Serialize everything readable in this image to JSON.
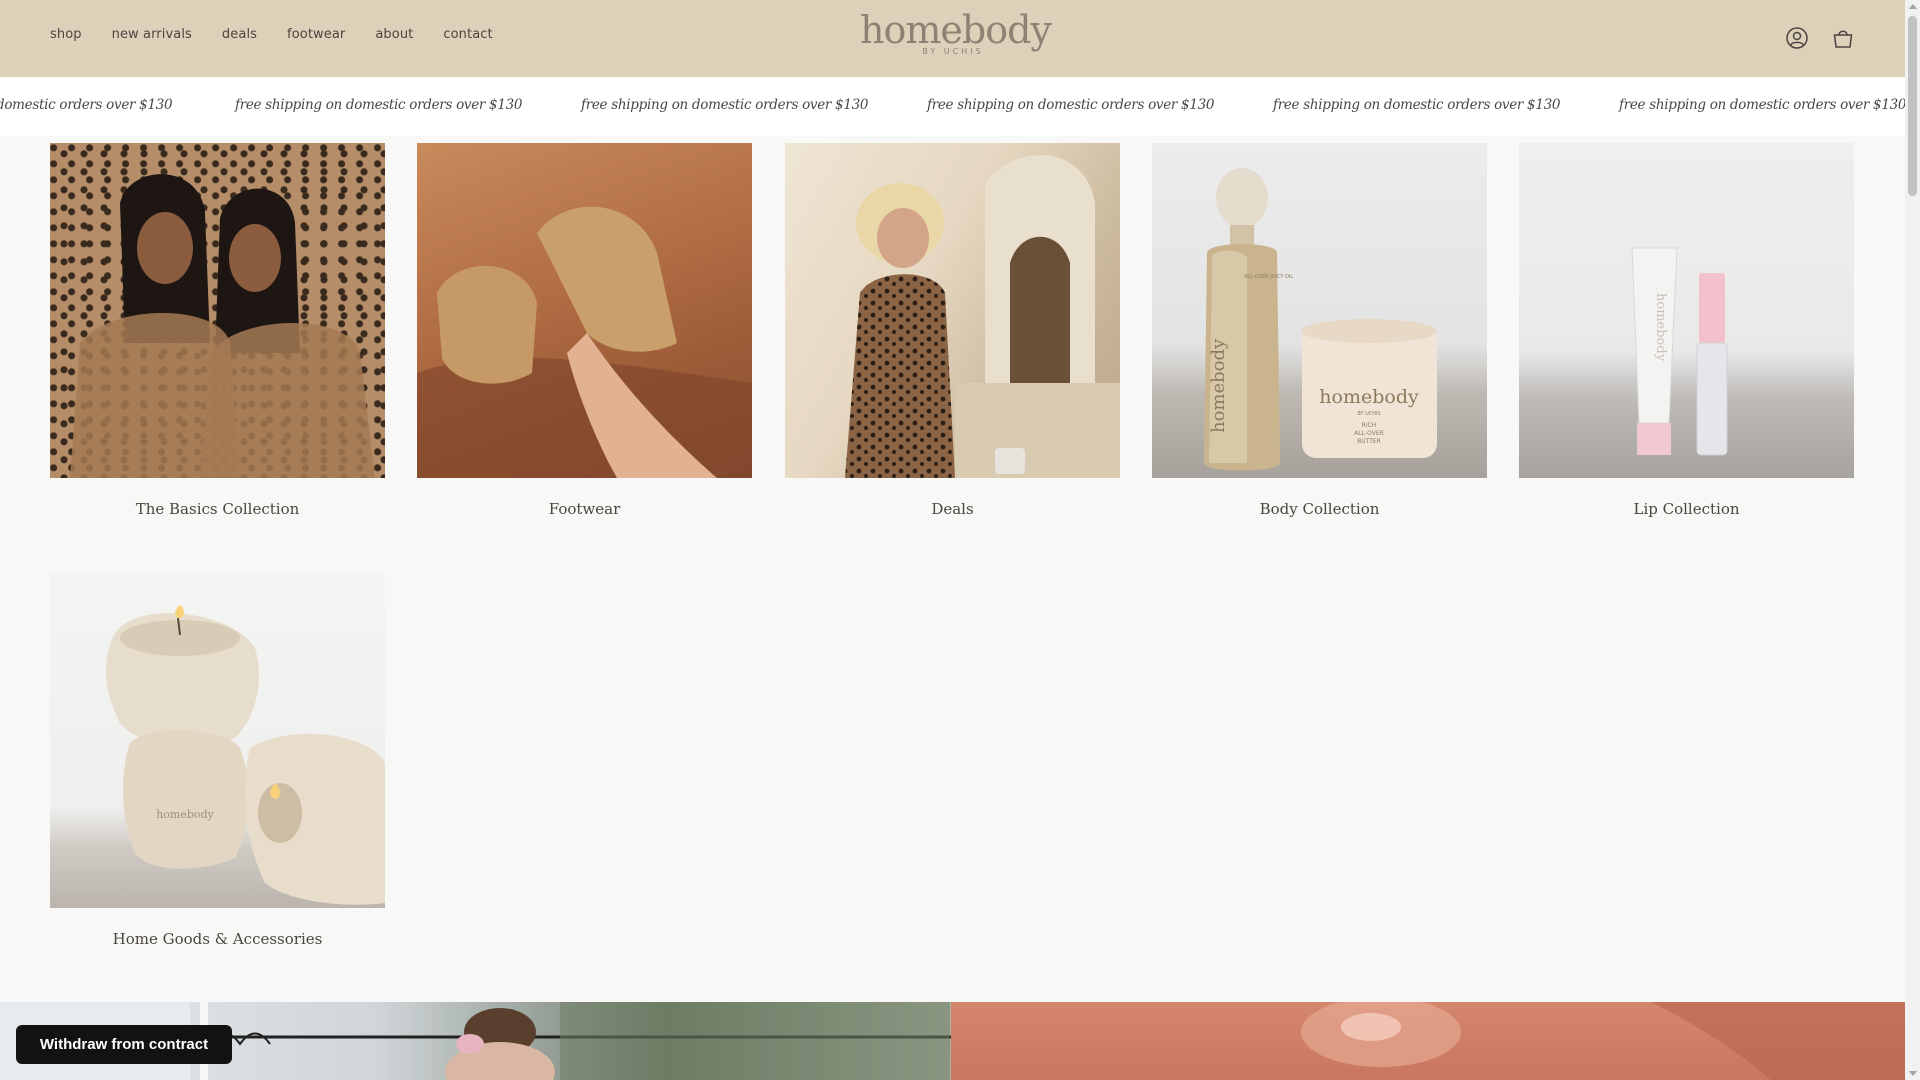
{
  "nav": {
    "items": [
      {
        "label": "shop"
      },
      {
        "label": "new arrivals"
      },
      {
        "label": "deals"
      },
      {
        "label": "footwear"
      },
      {
        "label": "about"
      },
      {
        "label": "contact"
      }
    ]
  },
  "logo": {
    "main": "homebody",
    "sub": "BY UCHIS"
  },
  "header_icons": [
    "account-icon",
    "cart-bag-icon"
  ],
  "announcement": {
    "messages": [
      "domestic orders over $130",
      "free shipping on domestic orders over $130",
      "free shipping on domestic orders over $130",
      "free shipping on domestic orders over $130",
      "free shipping on domestic orders over $130",
      "free shipping on domestic orders over $130"
    ]
  },
  "collections": [
    {
      "title": "The Basics Collection"
    },
    {
      "title": "Footwear"
    },
    {
      "title": "Deals"
    },
    {
      "title": "Body Collection"
    },
    {
      "title": "Lip Collection"
    },
    {
      "title": "Home Goods & Accessories"
    }
  ],
  "product_text": {
    "body_jar_brand": "homebody",
    "body_jar_sub": "BY UCHIS",
    "body_jar_line1": "RICH",
    "body_jar_line2": "ALL-OVER",
    "body_jar_line3": "BUTTER",
    "body_bottle_brand": "homebody",
    "body_bottle_label": "ALL-OVER JUICY OIL",
    "lip_tube_brand": "homebody",
    "candle_brand": "homebody"
  },
  "withdraw_button": {
    "label": "Withdraw from contract"
  },
  "colors": {
    "header_bg": "#ddd1b9",
    "page_bg": "#f8f8f6",
    "text": "#4a4540",
    "logo": "#8e8275",
    "withdraw_bg": "#121212"
  }
}
